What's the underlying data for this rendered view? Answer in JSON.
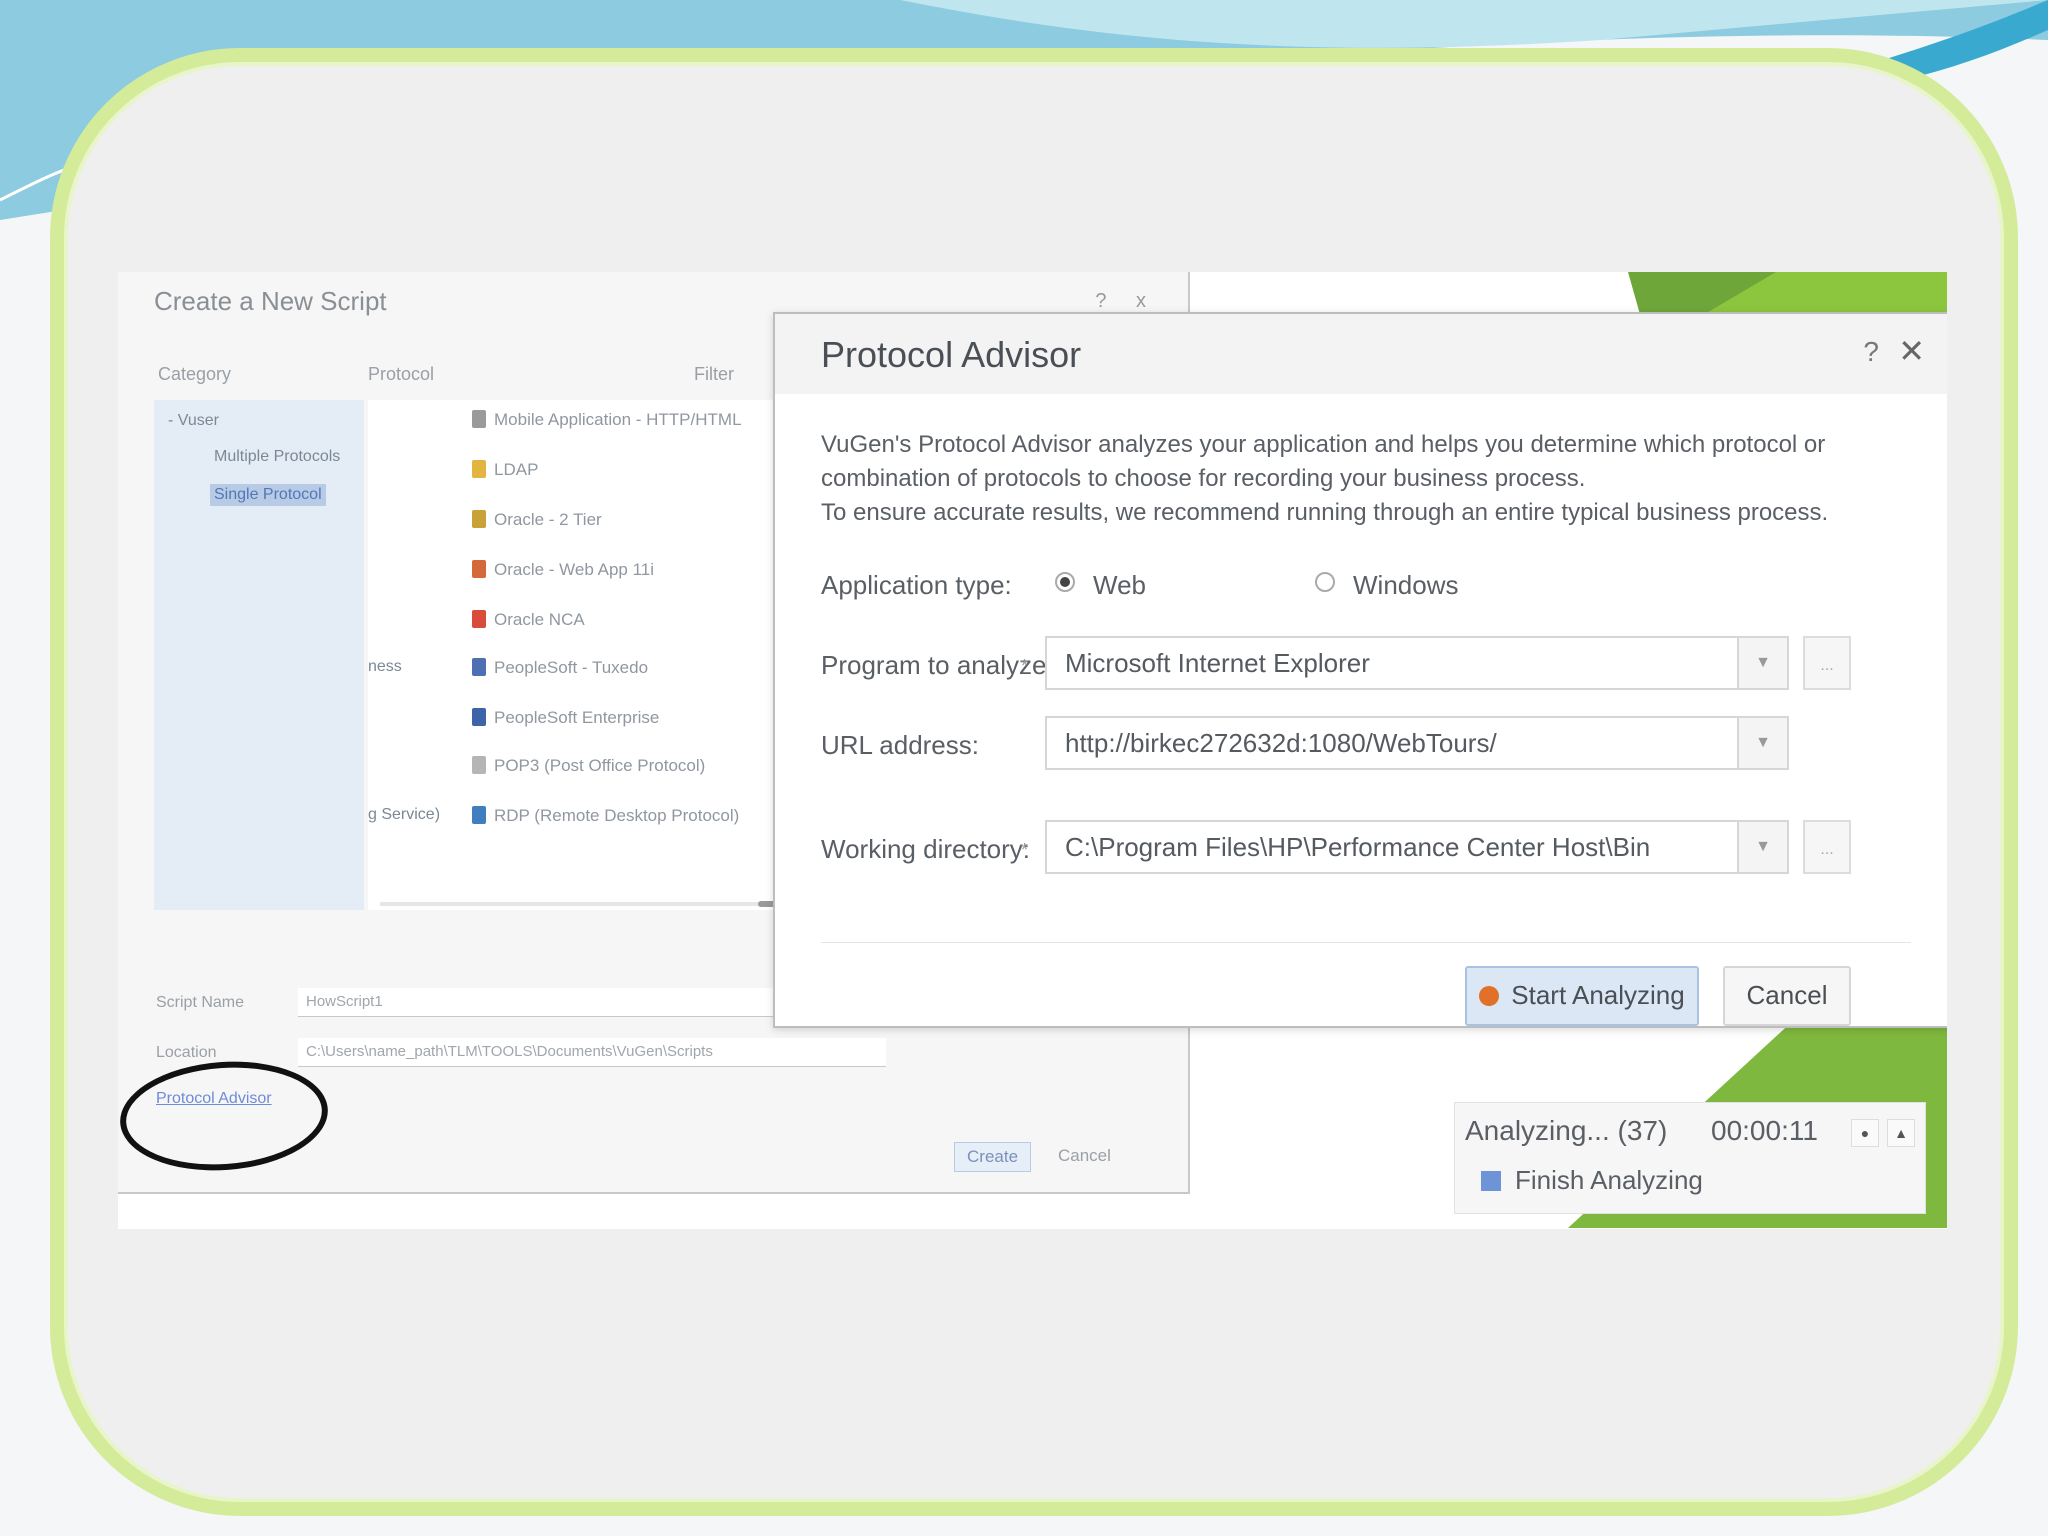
{
  "create_dialog": {
    "title": "Create a New Script",
    "help_close": "? x",
    "category_header": "Category",
    "protocol_header": "Protocol",
    "filter_label": "Filter",
    "categories": [
      "- Vuser",
      "Multiple Protocols",
      "Single Protocol"
    ],
    "protocols": [
      {
        "label": "Mobile Application - HTTP/HTML",
        "color": "#9a9a9a"
      },
      {
        "label": "LDAP",
        "color": "#e3b440"
      },
      {
        "label": "Oracle - 2 Tier",
        "color": "#c9a237"
      },
      {
        "label": "Oracle - Web App 11i",
        "color": "#d46a3b"
      },
      {
        "label": "Oracle NCA",
        "color": "#d94b3b"
      },
      {
        "label": "PeopleSoft - Tuxedo",
        "color": "#4f6fb3"
      },
      {
        "label": "PeopleSoft Enterprise",
        "color": "#3d63a8"
      },
      {
        "label": "POP3 (Post Office Protocol)",
        "color": "#b5b5b5"
      },
      {
        "label": "RDP (Remote Desktop Protocol)",
        "color": "#3f7fc0"
      }
    ],
    "partial_left_1": "ness",
    "partial_left_2": "g Service)",
    "script_name_label": "Script Name",
    "script_name_value": "HowScript1",
    "location_label": "Location",
    "location_value": "C:\\Users\\name_path\\TLM\\TOOLS\\Documents\\VuGen\\Scripts",
    "protocol_advisor_link": "Protocol Advisor",
    "create_button": "Create",
    "cancel_button": "Cancel"
  },
  "protocol_advisor": {
    "title": "Protocol Advisor",
    "help": "?",
    "close": "✕",
    "description_1": "VuGen's Protocol Advisor analyzes your application and helps you determine which protocol or",
    "description_2": "combination of protocols to choose for recording your business process.",
    "description_3": "To ensure accurate results, we recommend running through an entire typical business process.",
    "app_type_label": "Application type:",
    "app_type_options": [
      "Web",
      "Windows"
    ],
    "app_type_selected": "Web",
    "program_label": "Program to analyze:",
    "program_value": "Microsoft Internet Explorer",
    "url_label": "URL address:",
    "url_value": "http://birkec272632d:1080/WebTours/",
    "workdir_label": "Working directory:",
    "workdir_value": "C:\\Program Files\\HP\\Performance Center Host\\Bin",
    "required_mark": "*",
    "browse_label": "...",
    "start_button": "Start Analyzing",
    "cancel_button": "Cancel"
  },
  "analyzing_bar": {
    "status": "Analyzing... (37)",
    "elapsed": "00:00:11",
    "finish_label": "Finish Analyzing"
  }
}
